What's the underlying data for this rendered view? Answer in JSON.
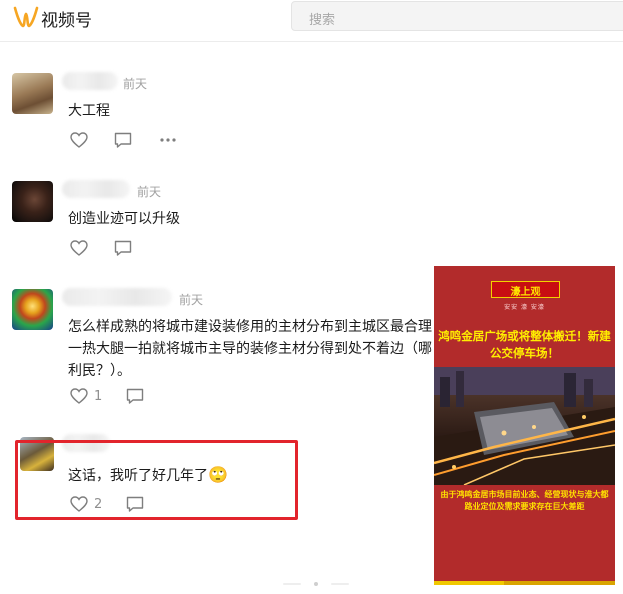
{
  "header": {
    "app_title": "视频号",
    "search_placeholder": "搜索"
  },
  "comments": [
    {
      "time": "前天",
      "text": "大工程",
      "like_count": "",
      "has_more": true
    },
    {
      "time": "前天",
      "text": "创造业迹可以升级",
      "like_count": ""
    },
    {
      "time": "前天",
      "text_lines": [
        "怎么样成熟的将城市建设装修用的主材分布到主城区最合理",
        "一热大腿一拍就将城市主导的装修主材分得到处不着边（哪",
        "利民？）。"
      ],
      "like_count": "1"
    },
    {
      "time": "",
      "text": "这话，我听了好几年了",
      "emoji": "🙄",
      "like_count": "2"
    }
  ],
  "video_card": {
    "brand": "濠上观",
    "brand_sub": "安安 濠 安濠",
    "headline": "鸿鸣金居广场或将整体搬迁！新建公交停车场！",
    "caption": "由于鸿鸣金居市场目前业态、经营现状与淮大都路业定位及需求要求存在巨大差距"
  },
  "colors": {
    "highlight_border": "#e2242c",
    "card_background": "#b22b2b",
    "card_text": "#ffee00",
    "logo": "#f6a623"
  }
}
